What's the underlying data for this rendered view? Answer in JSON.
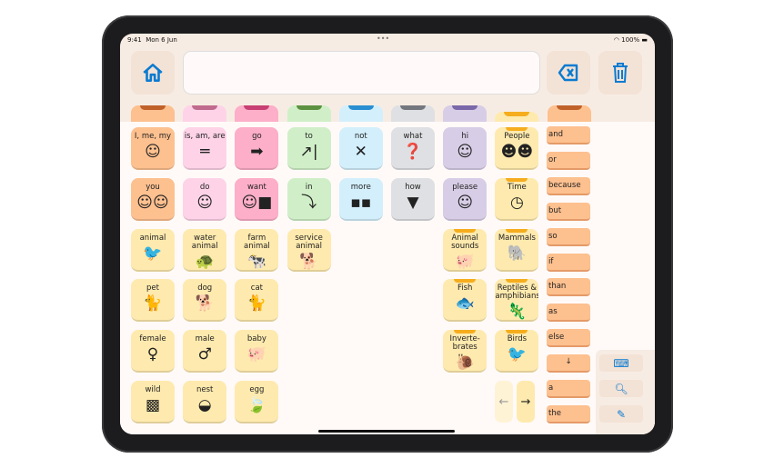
{
  "status": {
    "time": "9:41",
    "date": "Mon 6 Jun",
    "battery": "100%"
  },
  "toolbar": {
    "home_icon": "house-icon",
    "backspace_icon": "backspace-icon",
    "trash_icon": "trash-icon",
    "message": ""
  },
  "colors": {
    "orange": "#fdc08f",
    "lpink": "#fed3e8",
    "pink": "#fdaec8",
    "green": "#d0efc8",
    "blue": "#d3effc",
    "gray": "#dfe0e3",
    "purple": "#d7cde6",
    "yellow": "#feeaae",
    "accent": "#0a7bd1"
  },
  "tabs": [
    {
      "c": "orange",
      "k": "#c0612a"
    },
    {
      "c": "lpink",
      "k": "#c06b8e"
    },
    {
      "c": "pink",
      "k": "#c83f73"
    },
    {
      "c": "green",
      "k": "#5d9141"
    },
    {
      "c": "blue",
      "k": "#2a8fd2"
    },
    {
      "c": "gray",
      "k": "#74777d"
    },
    {
      "c": "purple",
      "k": "#7a68a8"
    },
    {
      "c": "yellow",
      "k": "#f5ad1e"
    },
    {
      "c": "orange",
      "k": "#c0612a"
    }
  ],
  "cells": [
    {
      "r": 0,
      "col": 0,
      "label": "I, me, my",
      "color": "orange",
      "icon": "person-self-icon"
    },
    {
      "r": 0,
      "col": 1,
      "label": "is, am, are",
      "color": "lpink",
      "icon": "equals-icon"
    },
    {
      "r": 0,
      "col": 2,
      "label": "go",
      "color": "pink",
      "icon": "arrow-right-icon"
    },
    {
      "r": 0,
      "col": 3,
      "label": "to",
      "color": "green",
      "icon": "arrow-to-line-icon"
    },
    {
      "r": 0,
      "col": 4,
      "label": "not",
      "color": "blue",
      "icon": "cross-icon"
    },
    {
      "r": 0,
      "col": 5,
      "label": "what",
      "color": "gray",
      "icon": "question-square-icon"
    },
    {
      "r": 0,
      "col": 6,
      "label": "hi",
      "color": "purple",
      "icon": "waving-person-icon"
    },
    {
      "r": 0,
      "col": 7,
      "label": "People",
      "color": "yellow",
      "icon": "people-icon",
      "folder": true
    },
    {
      "r": 1,
      "col": 0,
      "label": "you",
      "color": "orange",
      "icon": "two-people-icon"
    },
    {
      "r": 1,
      "col": 1,
      "label": "do",
      "color": "lpink",
      "icon": "person-pointing-icon"
    },
    {
      "r": 1,
      "col": 2,
      "label": "want",
      "color": "pink",
      "icon": "person-reaching-icon"
    },
    {
      "r": 1,
      "col": 3,
      "label": "in",
      "color": "green",
      "icon": "arrow-into-box-icon"
    },
    {
      "r": 1,
      "col": 4,
      "label": "more",
      "color": "blue",
      "icon": "more-blocks-icon"
    },
    {
      "r": 1,
      "col": 5,
      "label": "how",
      "color": "gray",
      "icon": "question-triangle-icon"
    },
    {
      "r": 1,
      "col": 6,
      "label": "please",
      "color": "purple",
      "icon": "person-please-icon"
    },
    {
      "r": 1,
      "col": 7,
      "label": "Time",
      "color": "yellow",
      "icon": "clock-calendar-icon",
      "folder": true
    },
    {
      "r": 2,
      "col": 0,
      "label": "animal",
      "color": "yellow",
      "icon": "animals-icon"
    },
    {
      "r": 2,
      "col": 1,
      "label": "water animal",
      "color": "yellow",
      "icon": "turtle-icon"
    },
    {
      "r": 2,
      "col": 2,
      "label": "farm animal",
      "color": "yellow",
      "icon": "cow-icon"
    },
    {
      "r": 2,
      "col": 3,
      "label": "service animal",
      "color": "yellow",
      "icon": "service-dog-icon"
    },
    {
      "r": 2,
      "col": 6,
      "label": "Animal sounds",
      "color": "yellow",
      "icon": "farm-animals-icon",
      "folder": true
    },
    {
      "r": 2,
      "col": 7,
      "label": "Mammals",
      "color": "yellow",
      "icon": "elephant-icon",
      "folder": true
    },
    {
      "r": 3,
      "col": 0,
      "label": "pet",
      "color": "yellow",
      "icon": "pets-icon"
    },
    {
      "r": 3,
      "col": 1,
      "label": "dog",
      "color": "yellow",
      "icon": "dog-icon"
    },
    {
      "r": 3,
      "col": 2,
      "label": "cat",
      "color": "yellow",
      "icon": "cat-icon"
    },
    {
      "r": 3,
      "col": 6,
      "label": "Fish",
      "color": "yellow",
      "icon": "fish-icon",
      "folder": true
    },
    {
      "r": 3,
      "col": 7,
      "label": "Reptiles & amphibians",
      "color": "yellow",
      "icon": "lizard-icon",
      "folder": true
    },
    {
      "r": 4,
      "col": 0,
      "label": "female",
      "color": "yellow",
      "icon": "female-symbol-icon"
    },
    {
      "r": 4,
      "col": 1,
      "label": "male",
      "color": "yellow",
      "icon": "male-symbol-icon"
    },
    {
      "r": 4,
      "col": 2,
      "label": "baby",
      "color": "yellow",
      "icon": "baby-animals-icon"
    },
    {
      "r": 4,
      "col": 6,
      "label": "Inverte-brates",
      "color": "yellow",
      "icon": "snail-icon",
      "folder": true
    },
    {
      "r": 4,
      "col": 7,
      "label": "Birds",
      "color": "yellow",
      "icon": "bird-icon",
      "folder": true
    },
    {
      "r": 5,
      "col": 0,
      "label": "wild",
      "color": "yellow",
      "icon": "landscape-icon"
    },
    {
      "r": 5,
      "col": 1,
      "label": "nest",
      "color": "yellow",
      "icon": "nest-icon"
    },
    {
      "r": 5,
      "col": 2,
      "label": "egg",
      "color": "yellow",
      "icon": "egg-leaf-icon"
    }
  ],
  "pager": {
    "prev": "←",
    "next": "→"
  },
  "words": [
    "and",
    "or",
    "because",
    "but",
    "so",
    "if",
    "than",
    "as",
    "else",
    "↓",
    "a",
    "the"
  ],
  "panel": {
    "keyboard_icon": "keyboard-icon",
    "search_icon": "search-icon",
    "pencil_icon": "pencil-icon"
  }
}
